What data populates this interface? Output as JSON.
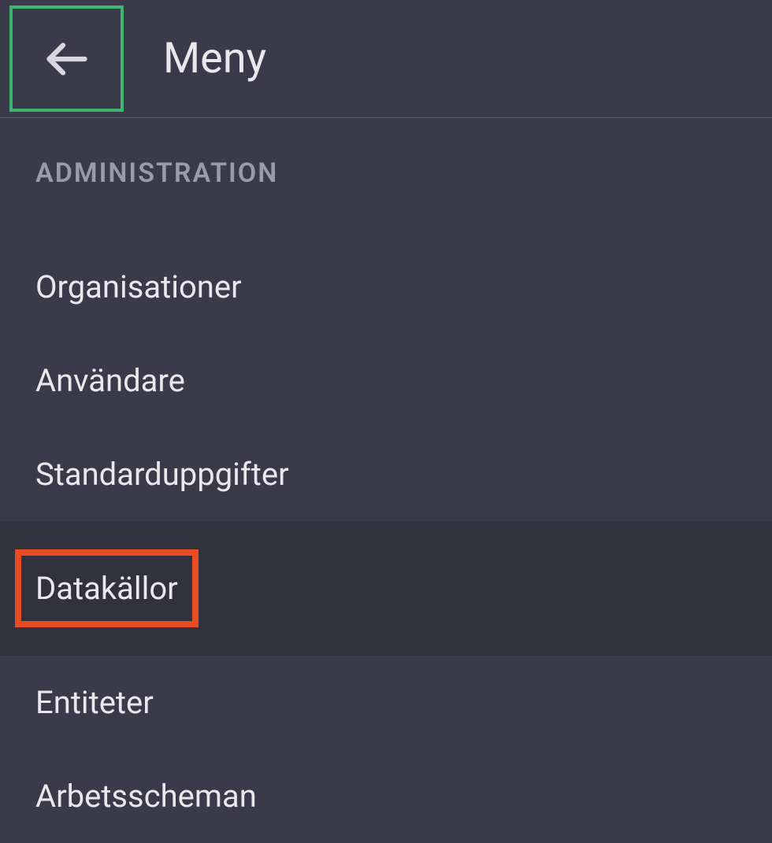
{
  "header": {
    "title": "Meny"
  },
  "section": {
    "label": "ADMINISTRATION"
  },
  "menu": {
    "items": [
      {
        "label": "Organisationer"
      },
      {
        "label": "Användare"
      },
      {
        "label": "Standarduppgifter"
      },
      {
        "label": "Datakällor"
      },
      {
        "label": "Entiteter"
      },
      {
        "label": "Arbetsscheman"
      }
    ]
  }
}
